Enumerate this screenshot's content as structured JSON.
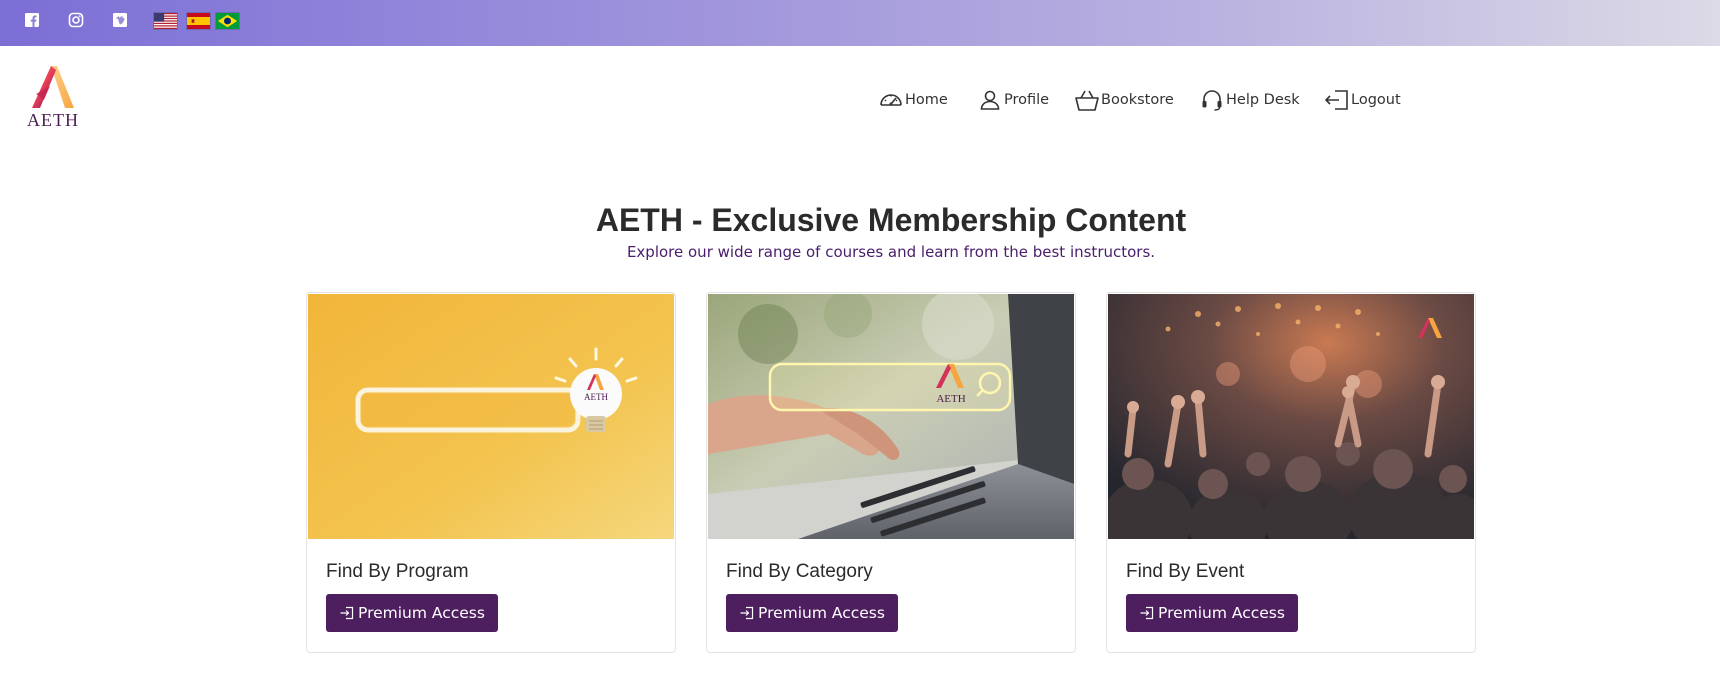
{
  "topbar": {
    "social": [
      "facebook-icon",
      "instagram-icon",
      "vimeo-icon"
    ],
    "languages": [
      "English",
      "Español",
      "Português"
    ]
  },
  "brand": {
    "name": "AETH",
    "colors": {
      "primary": "#4e1f5f",
      "accent": "#7b6fd6",
      "subtitle": "#4a1d6b"
    }
  },
  "nav": {
    "items": [
      {
        "label": "Home",
        "icon": "speedometer-icon"
      },
      {
        "label": "Profile",
        "icon": "person-icon"
      },
      {
        "label": "Bookstore",
        "icon": "basket-icon"
      },
      {
        "label": "Help Desk",
        "icon": "headset-icon"
      },
      {
        "label": "Logout",
        "icon": "logout-icon"
      }
    ]
  },
  "hero": {
    "title": "AETH - Exclusive Membership Content",
    "subtitle": "Explore our wide range of courses and learn from the best instructors."
  },
  "cards": [
    {
      "title": "Find By Program",
      "button": "Premium Access",
      "image_caption": "AETH"
    },
    {
      "title": "Find By Category",
      "button": "Premium Access",
      "image_caption": "AETH"
    },
    {
      "title": "Find By Event",
      "button": "Premium Access"
    }
  ]
}
